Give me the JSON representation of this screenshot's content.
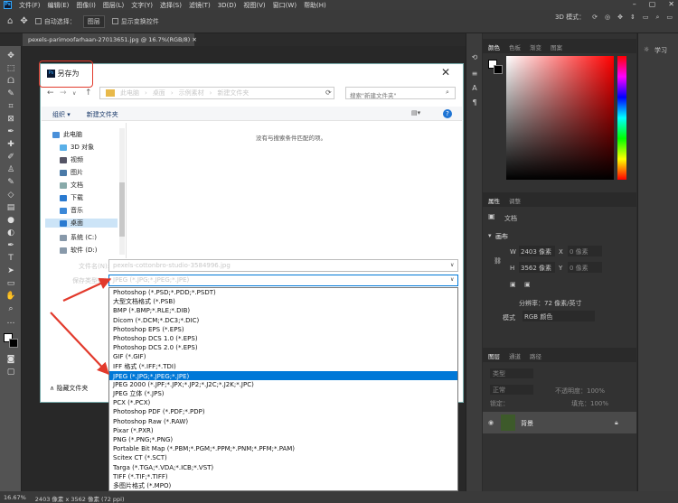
{
  "menubar": {
    "items": [
      "文件(F)",
      "编辑(E)",
      "图像(I)",
      "图层(L)",
      "文字(Y)",
      "选择(S)",
      "滤镜(T)",
      "3D(D)",
      "视图(V)",
      "窗口(W)",
      "帮助(H)"
    ]
  },
  "options": {
    "auto_select": "自动选择：",
    "layer_select": "图层",
    "transform": "显示变换控件",
    "mode3d": "3D 模式："
  },
  "document": {
    "tab_title": "pexels-parimoofarhaan-27013651.jpg @ 16.7%(RGB/8)"
  },
  "panels": {
    "color_tabs": [
      "颜色",
      "色板",
      "渐变",
      "图案"
    ],
    "props_tabs": [
      "属性",
      "调整"
    ],
    "doc_label": "文档",
    "canvas_label": "画布",
    "width_label": "W",
    "width": "2403 像素",
    "x_label": "X",
    "x_ph": "0 像素",
    "height_label": "H",
    "height": "3562 像素",
    "y_label": "Y",
    "y_ph": "0 像素",
    "resolution": "分辨率：72 像素/英寸",
    "mode_label": "模式",
    "mode": "RGB 颜色",
    "layers_tabs": [
      "图层",
      "通道",
      "路径"
    ],
    "layer_kind": "类型",
    "layer_blend": "正常",
    "opacity": "不透明度：100%",
    "lock": "锁定：",
    "fill": "填充：100%",
    "layer_name": "背景",
    "learn": "学习"
  },
  "status": {
    "zoom": "16.67%",
    "size": "2403 像素 x 3562 像素 (72 ppi)"
  },
  "dialog": {
    "title": "另存为",
    "breadcrumb": [
      "此电脑",
      "桌面",
      "示例素材",
      "新建文件夹"
    ],
    "search_placeholder": "搜索\"新建文件夹\"",
    "organize": "组织 ▾",
    "new_folder": "新建文件夹",
    "nav": [
      "此电脑",
      "3D 对象",
      "视频",
      "图片",
      "文档",
      "下载",
      "音乐",
      "桌面",
      "系统 (C:)",
      "软件 (D:)"
    ],
    "empty_msg": "没有与搜索条件匹配的项。",
    "filename_label": "文件名(N):",
    "filename": "pexels-cottonbro-studio-3584996.jpg",
    "filetype_label": "保存类型(T):",
    "filetype": "JPEG (*.JPG;*.JPEG;*.JPE)",
    "hide_folders": "隐藏文件夹",
    "options": [
      "Photoshop (*.PSD;*.PDD;*.PSDT)",
      "大型文档格式 (*.PSB)",
      "BMP (*.BMP;*.RLE;*.DIB)",
      "Dicom (*.DCM;*.DC3;*.DIC)",
      "Photoshop EPS (*.EPS)",
      "Photoshop DCS 1.0 (*.EPS)",
      "Photoshop DCS 2.0 (*.EPS)",
      "GIF (*.GIF)",
      "IFF 格式 (*.IFF;*.TDI)",
      "JPEG (*.JPG;*.JPEG;*.JPE)",
      "JPEG 2000 (*.JPF;*.JPX;*.JP2;*.J2C;*.J2K;*.JPC)",
      "JPEG 立体 (*.JPS)",
      "PCX (*.PCX)",
      "Photoshop PDF (*.PDF;*.PDP)",
      "Photoshop Raw (*.RAW)",
      "Pixar (*.PXR)",
      "PNG (*.PNG;*.PNG)",
      "Portable Bit Map (*.PBM;*.PGM;*.PPM;*.PNM;*.PFM;*.PAM)",
      "Scitex CT (*.SCT)",
      "Targa (*.TGA;*.VDA;*.ICB;*.VST)",
      "TIFF (*.TIF;*.TIFF)",
      "多图片格式 (*.MPO)"
    ],
    "selected_index": 9
  },
  "colors": {
    "highlight": "#e23a2c",
    "selection": "#0078d7"
  }
}
